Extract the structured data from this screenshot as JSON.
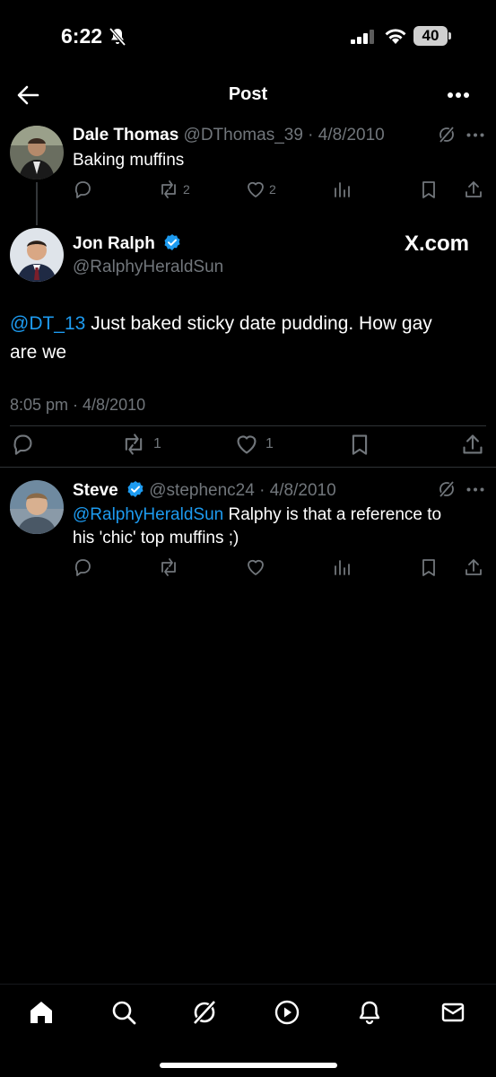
{
  "status": {
    "time": "6:22",
    "battery": "40"
  },
  "header": {
    "title": "Post"
  },
  "parent": {
    "name": "Dale Thomas",
    "handle": "@DThomas_39",
    "date": "· 4/8/2010",
    "text": "Baking muffins",
    "retweets": "2",
    "likes": "2"
  },
  "main": {
    "name": "Jon Ralph",
    "handle": "@RalphyHeraldSun",
    "watermark": "X.com",
    "mention": "@DT_13",
    "text_line1": " Just baked sticky date pudding. How gay",
    "text_line2": "are we",
    "timestamp": "8:05 pm · 4/8/2010",
    "retweets": "1",
    "likes": "1"
  },
  "reply": {
    "name": "Steve",
    "handle": "@stephenc24",
    "date": "· 4/8/2010",
    "mention": "@RalphyHeraldSun",
    "text_line1": " Ralphy is that a reference to",
    "text_line2": "his 'chic' top muffins ;)"
  },
  "colors": {
    "accent": "#1d9bf0",
    "muted": "#71767b",
    "background": "#000000"
  }
}
